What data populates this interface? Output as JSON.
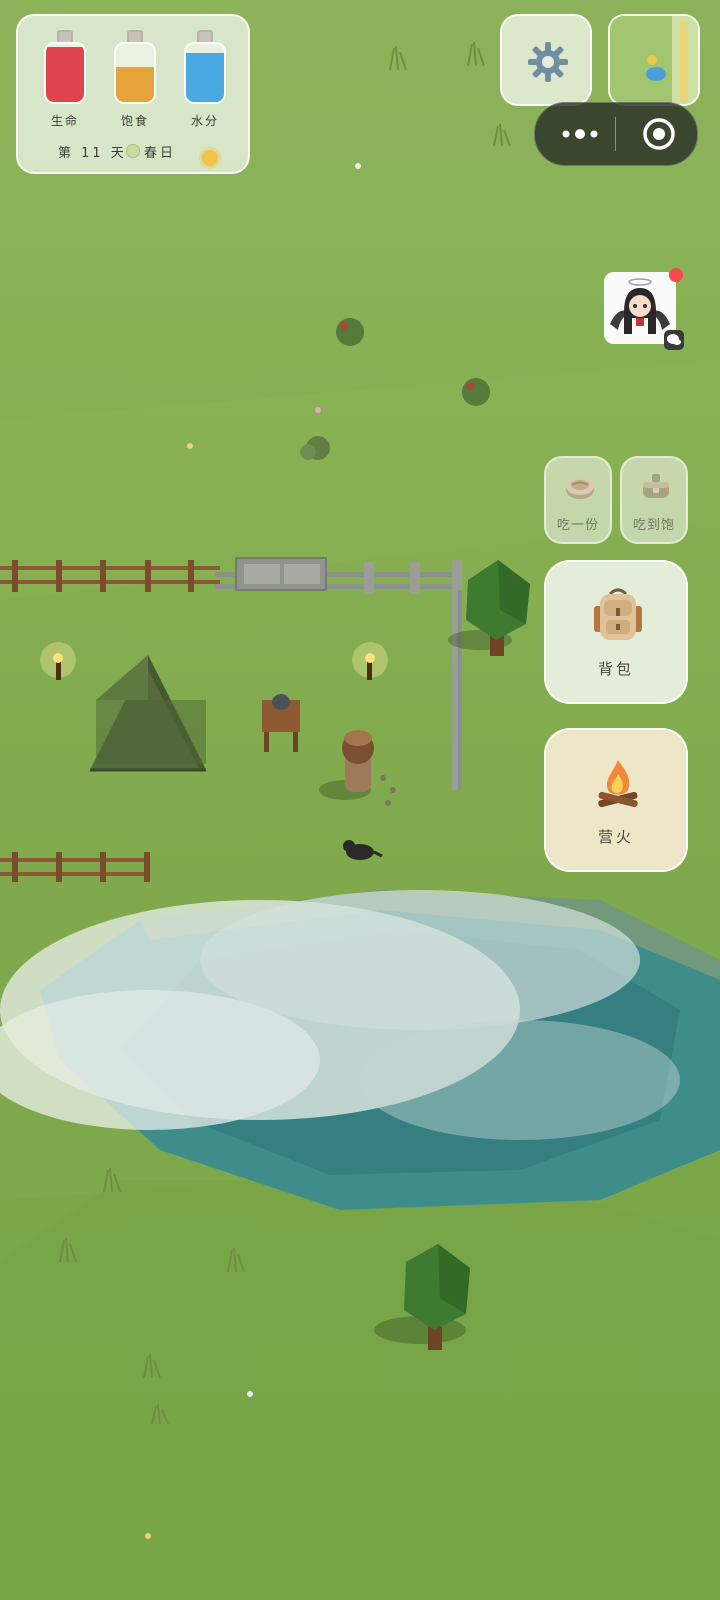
{
  "hud": {
    "stats": [
      {
        "label": "生命",
        "fill": 0.95,
        "color": "#e0454f"
      },
      {
        "label": "饱食",
        "fill": 0.6,
        "color": "#e5a33a"
      },
      {
        "label": "水分",
        "fill": 0.85,
        "color": "#4aa8e3"
      }
    ],
    "day_text": "第 11 天",
    "season_text": "春日"
  },
  "actions": {
    "eat_one": "吃一份",
    "eat_full": "吃到饱",
    "backpack": "背包",
    "campfire": "营火"
  },
  "icons": {
    "settings": "gear-icon",
    "menu": "more-dots-icon",
    "close": "target-circle-icon",
    "backpack": "backpack-icon",
    "campfire": "campfire-icon",
    "meat": "meat-icon",
    "pot": "pot-icon"
  },
  "colors": {
    "grass": "#86b052",
    "water": "#3f8d8a",
    "fog": "#e8eee8"
  }
}
